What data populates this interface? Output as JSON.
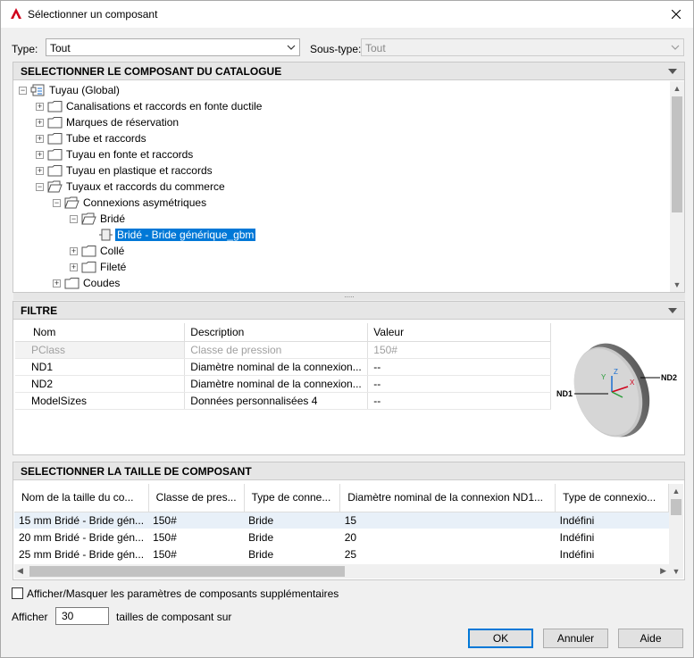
{
  "window": {
    "title": "Sélectionner un composant"
  },
  "type_row": {
    "type_label": "Type:",
    "type_value": "Tout",
    "subtype_label": "Sous-type:",
    "subtype_value": "Tout"
  },
  "catalog": {
    "header": "SELECTIONNER LE COMPOSANT DU CATALOGUE",
    "tree": [
      {
        "label": "Tuyau (Global)",
        "expander": "−",
        "icon": "catalog-icon"
      },
      {
        "label": "Canalisations et raccords en fonte ductile",
        "expander": "+",
        "icon": "folder-icon"
      },
      {
        "label": "Marques de réservation",
        "expander": "+",
        "icon": "folder-icon"
      },
      {
        "label": "Tube et raccords",
        "expander": "+",
        "icon": "folder-icon"
      },
      {
        "label": "Tuyau en fonte et raccords",
        "expander": "+",
        "icon": "folder-icon"
      },
      {
        "label": "Tuyau en plastique et raccords",
        "expander": "+",
        "icon": "folder-icon"
      },
      {
        "label": "Tuyaux et raccords du commerce",
        "expander": "−",
        "icon": "folder-open-icon"
      },
      {
        "label": "Connexions asymétriques",
        "expander": "−",
        "icon": "folder-open-icon"
      },
      {
        "label": "Bridé",
        "expander": "−",
        "icon": "folder-open-icon"
      },
      {
        "label": "Bridé - Bride générique_gbm",
        "expander": "",
        "icon": "part-icon",
        "selected": true
      },
      {
        "label": "Collé",
        "expander": "+",
        "icon": "folder-icon"
      },
      {
        "label": "Fileté",
        "expander": "+",
        "icon": "folder-icon"
      },
      {
        "label": "Coudes",
        "expander": "+",
        "icon": "folder-icon"
      }
    ],
    "splitter_grip": "....."
  },
  "filter": {
    "header": "FILTRE",
    "columns": [
      "Nom",
      "Description",
      "Valeur"
    ],
    "rows": [
      {
        "name": "PClass",
        "description": "Classe de pression",
        "value": "150#"
      },
      {
        "name": "ND1",
        "description": "Diamètre nominal de la connexion...",
        "value": "--"
      },
      {
        "name": "ND2",
        "description": "Diamètre nominal de la connexion...",
        "value": "--"
      },
      {
        "name": "ModelSizes",
        "description": "Données personnalisées 4",
        "value": "--"
      }
    ],
    "preview": {
      "label_left": "ND1",
      "label_right": "ND2",
      "axis_z": "Z",
      "axis_x": "X",
      "axis_y": "Y"
    }
  },
  "sizes": {
    "header": "SELECTIONNER LA TAILLE DE COMPOSANT",
    "columns": [
      "Nom de la taille du co...",
      "Classe de pres...",
      "Type de conne...",
      "Diamètre nominal de la connexion ND1...",
      "Type de connexio..."
    ],
    "rows": [
      [
        "15 mm Bridé - Bride gén...",
        "150#",
        "Bride",
        "15",
        "Indéfini"
      ],
      [
        "20 mm Bridé - Bride gén...",
        "150#",
        "Bride",
        "20",
        "Indéfini"
      ],
      [
        "25 mm Bridé - Bride gén...",
        "150#",
        "Bride",
        "25",
        "Indéfini"
      ]
    ]
  },
  "options": {
    "show_hide_label": "Afficher/Masquer les paramètres de composants supplémentaires",
    "show_hide_checked": false,
    "afficher_label": "Afficher",
    "count_value": "30",
    "count_suffix": "tailles de composant sur"
  },
  "buttons": {
    "ok": "OK",
    "cancel": "Annuler",
    "help": "Aide"
  },
  "colors": {
    "selection": "#0078d7",
    "panel_header": "#e6e6e6"
  }
}
